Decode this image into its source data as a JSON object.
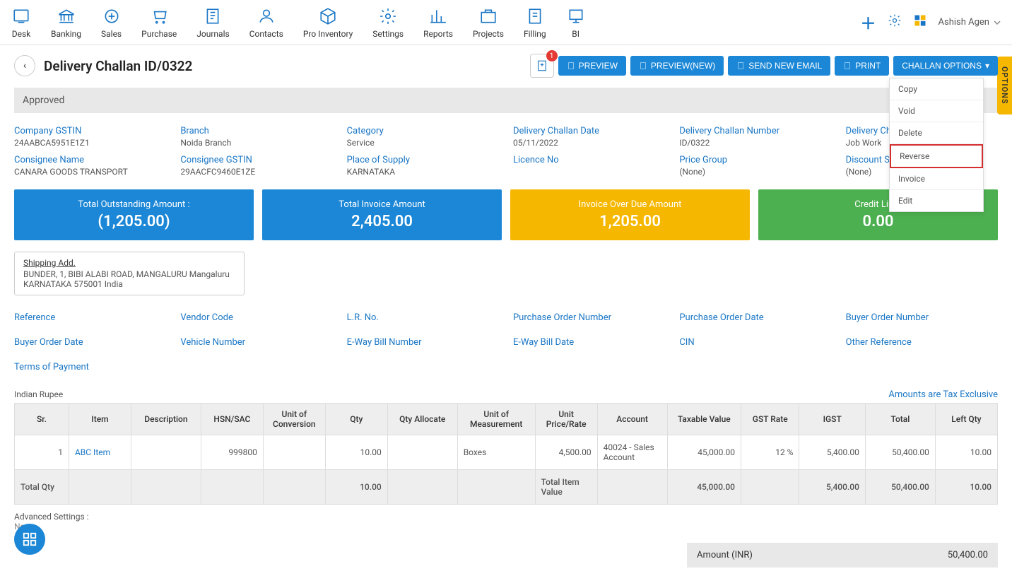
{
  "nav": {
    "items": [
      "Desk",
      "Banking",
      "Sales",
      "Purchase",
      "Journals",
      "Contacts",
      "Pro Inventory",
      "Settings",
      "Reports",
      "Projects",
      "Filling",
      "BI"
    ],
    "user": "Ashish Agen"
  },
  "options_tab": "OPTIONS",
  "header": {
    "title": "Delivery Challan ID/0322",
    "badge": "1",
    "btn_preview": "PREVIEW",
    "btn_preview_new": "PREVIEW(NEW)",
    "btn_email": "SEND NEW EMAIL",
    "btn_print": "PRINT",
    "btn_options": "CHALLAN OPTIONS"
  },
  "dropdown": {
    "copy": "Copy",
    "void": "Void",
    "delete": "Delete",
    "reverse": "Reverse",
    "invoice": "Invoice",
    "edit": "Edit"
  },
  "status": "Approved",
  "meta": {
    "company_gstin": {
      "label": "Company GSTIN",
      "value": "24AABCA5951E1Z1"
    },
    "branch": {
      "label": "Branch",
      "value": "Noida Branch"
    },
    "category": {
      "label": "Category",
      "value": "Service"
    },
    "dc_date": {
      "label": "Delivery Challan Date",
      "value": "05/11/2022"
    },
    "dc_number": {
      "label": "Delivery Challan Number",
      "value": "ID/0322"
    },
    "dc_type": {
      "label": "Delivery Challa",
      "value": "Job Work"
    },
    "consignee_name": {
      "label": "Consignee Name",
      "value": "CANARA GOODS TRANSPORT"
    },
    "consignee_gstin": {
      "label": "Consignee GSTIN",
      "value": "29AACFC9460E1ZE"
    },
    "place_supply": {
      "label": "Place of Supply",
      "value": "KARNATAKA"
    },
    "licence": {
      "label": "Licence No",
      "value": ""
    },
    "price_group": {
      "label": "Price Group",
      "value": "(None)"
    },
    "discount_scheme": {
      "label": "Discount Sche",
      "value": "(None)"
    }
  },
  "cards": {
    "outstanding": {
      "label": "Total Outstanding Amount :",
      "value": "(1,205.00)"
    },
    "invoice": {
      "label": "Total Invoice Amount",
      "value": "2,405.00"
    },
    "overdue": {
      "label": "Invoice Over Due Amount",
      "value": "1,205.00"
    },
    "credit": {
      "label": "Credit Limit",
      "value": "0.00"
    }
  },
  "shipping": {
    "title": "Shipping Add.",
    "line1": "BUNDER, 1, BIBI ALABI ROAD, MANGALURU Mangaluru",
    "line2": "KARNATAKA 575001 India"
  },
  "refs": {
    "reference": "Reference",
    "vendor_code": "Vendor Code",
    "lr_no": "L.R. No.",
    "po_number": "Purchase Order Number",
    "po_date": "Purchase Order Date",
    "buyer_order_no": "Buyer Order Number",
    "buyer_order_date": "Buyer Order Date",
    "vehicle_no": "Vehicle Number",
    "eway_no": "E-Way Bill Number",
    "eway_date": "E-Way Bill Date",
    "cin": "CIN",
    "other_ref": "Other Reference",
    "terms": "Terms of Payment"
  },
  "currency_left": "Indian Rupee",
  "currency_right": "Amounts are Tax Exclusive",
  "table": {
    "headers": {
      "sr": "Sr.",
      "item": "Item",
      "desc": "Description",
      "hsn": "HSN/SAC",
      "uoc": "Unit of Conversion",
      "qty": "Qty",
      "qtya": "Qty Allocate",
      "uom": "Unit of Measurement",
      "rate": "Unit Price/Rate",
      "account": "Account",
      "taxable": "Taxable Value",
      "gstrate": "GST Rate",
      "igst": "IGST",
      "total": "Total",
      "leftqty": "Left Qty"
    },
    "row": {
      "sr": "1",
      "item": "ABC Item",
      "desc": "",
      "hsn": "999800",
      "uoc": "",
      "qty": "10.00",
      "qtya": "",
      "uom": "Boxes",
      "rate": "4,500.00",
      "account": "40024 - Sales Account",
      "taxable": "45,000.00",
      "gstrate": "12 %",
      "igst": "5,400.00",
      "total": "50,400.00",
      "leftqty": "10.00"
    },
    "totals": {
      "label": "Total Qty",
      "qty": "10.00",
      "itemprice": "Total Item Value",
      "taxable": "45,000.00",
      "igst": "5,400.00",
      "total": "50,400.00",
      "leftqty": "10.00"
    }
  },
  "adv": {
    "label": "Advanced Settings :",
    "value": "None"
  },
  "amount_row": {
    "label": "Amount (INR)",
    "value": "50,400.00"
  }
}
